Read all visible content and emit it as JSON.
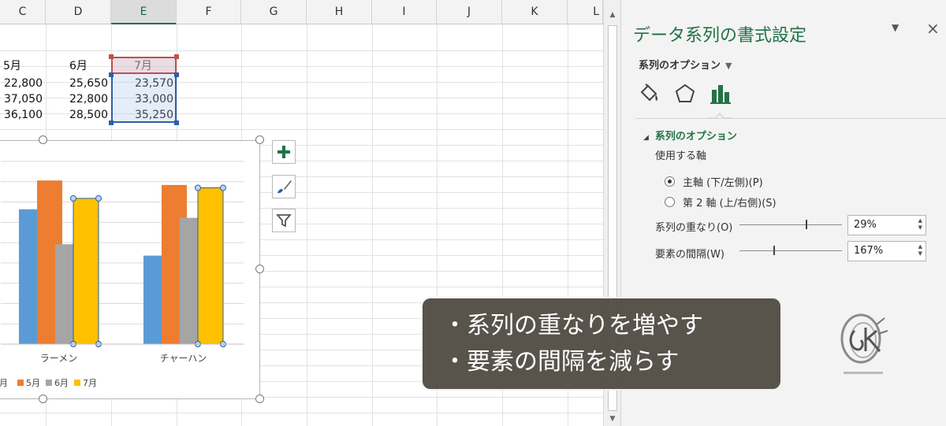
{
  "sheet": {
    "columns": [
      "C",
      "D",
      "E",
      "F",
      "G",
      "H",
      "I",
      "J",
      "K",
      "L"
    ],
    "selected_column": "E",
    "header_row": [
      "5月",
      "6月",
      "7月"
    ],
    "rows": [
      [
        "22,800",
        "25,650",
        "23,570"
      ],
      [
        "37,050",
        "22,800",
        "33,000"
      ],
      [
        "36,100",
        "28,500",
        "35,250"
      ]
    ]
  },
  "chart": {
    "buttons": [
      {
        "name": "chart-elements-button",
        "icon": "plus-icon"
      },
      {
        "name": "chart-styles-button",
        "icon": "brush-icon"
      },
      {
        "name": "chart-filters-button",
        "icon": "filter-icon"
      }
    ]
  },
  "chart_data": {
    "type": "bar",
    "categories": [
      "ラーメン",
      "チャーハン"
    ],
    "series": [
      {
        "name": "",
        "values": [
          33200,
          21800
        ],
        "color": "#5b9bd5"
      },
      {
        "name": "5月",
        "values": [
          40300,
          39200
        ],
        "color": "#ed7d31"
      },
      {
        "name": "6月",
        "values": [
          24600,
          31100
        ],
        "color": "#a5a5a5"
      },
      {
        "name": "7月",
        "values": [
          35900,
          38500
        ],
        "color": "#ffc000"
      }
    ],
    "legend_partial_first": "月",
    "ylim": [
      0,
      45000
    ],
    "grid": true,
    "legend": "bottom"
  },
  "pane": {
    "title": "データ系列の書式設定",
    "minimize_glyph": "▼",
    "close_glyph": "×",
    "options_dropdown": "系列のオプション",
    "tabs": [
      {
        "name": "fill-line-tab",
        "icon": "paint-bucket-icon"
      },
      {
        "name": "effects-tab",
        "icon": "pentagon-icon"
      },
      {
        "name": "series-options-tab",
        "icon": "bar-chart-icon",
        "active": true
      }
    ],
    "section_title": "系列のオプション",
    "axis_label": "使用する軸",
    "radio_primary": "主軸 (下/左側)(P)",
    "radio_secondary": "第 2 軸 (上/右側)(S)",
    "overlap_label": "系列の重なり(O)",
    "overlap_value": "29%",
    "overlap_fraction": 0.645,
    "gap_label": "要素の間隔(W)",
    "gap_value": "167%",
    "gap_fraction": 0.334
  },
  "caption": {
    "line1": "・系列の重なりを増やす",
    "line2": "・要素の間隔を減らす"
  },
  "colors": {
    "excel_green": "#217346",
    "selection_blue": "#2e5fa8",
    "selection_red": "#c0504d"
  }
}
